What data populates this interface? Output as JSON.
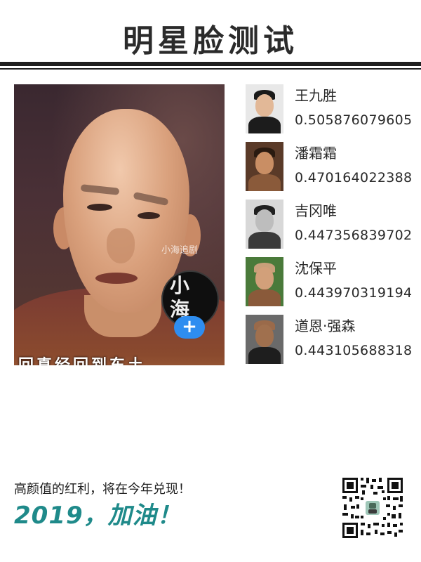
{
  "header": {
    "title": "明星脸测试"
  },
  "main_photo": {
    "watermark": "小海追剧",
    "badge_text": "小海",
    "add_button_label": "+",
    "subtitle": "回真经回到东土"
  },
  "results": [
    {
      "name": "王九胜",
      "score": "0.505876079605"
    },
    {
      "name": "潘霜霜",
      "score": "0.470164022388"
    },
    {
      "name": "吉冈唯",
      "score": "0.447356839702"
    },
    {
      "name": "沈保平",
      "score": "0.443970319194"
    },
    {
      "name": "道恩·强森",
      "score": "0.443105688318"
    }
  ],
  "footer": {
    "tagline": "高颜值的红利，将在今年兑现！",
    "slogan": "2019，加油！"
  },
  "colors": {
    "slogan": "#1f8a8a",
    "add_button": "#2e8df0",
    "rule": "#1f1f1f"
  }
}
